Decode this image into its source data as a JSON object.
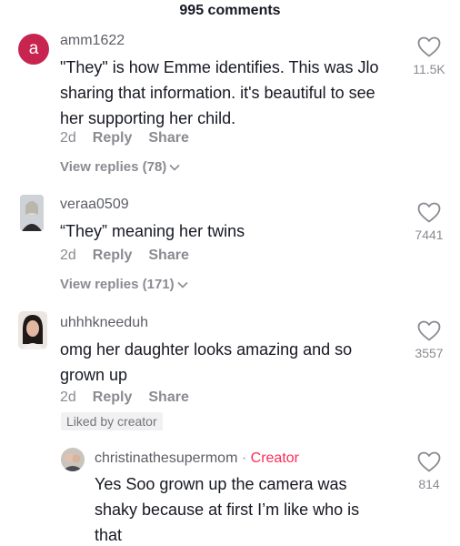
{
  "header": {
    "title": "995 comments"
  },
  "comments": [
    {
      "avatar_letter": "a",
      "avatar_color": "#c7254f",
      "username": "amm1622",
      "lines": [
        "\"They\" is how Emme identifies. This was Jlo",
        "sharing that information. it's beautiful to see",
        "her supporting her child."
      ],
      "time": "2d",
      "reply_label": "Reply",
      "share_label": "Share",
      "view_replies": "View replies (78)",
      "likes": "11.5K"
    },
    {
      "avatar_icon": "user-photo",
      "username": "veraa0509",
      "lines": [
        "“They” meaning her twins"
      ],
      "time": "2d",
      "reply_label": "Reply",
      "share_label": "Share",
      "view_replies": "View replies (171)",
      "likes": "7441"
    },
    {
      "avatar_icon": "user-photo",
      "username": "uhhhkneeduh",
      "lines": [
        "omg her daughter looks amazing and so",
        "grown up"
      ],
      "time": "2d",
      "reply_label": "Reply",
      "share_label": "Share",
      "liked_by": "Liked by creator",
      "likes": "3557"
    }
  ],
  "reply": {
    "avatar_icon": "user-photo",
    "username": "christinathesupermom",
    "separator": "·",
    "creator_label": "Creator",
    "lines": [
      "Yes Soo grown up the camera was",
      "shaky because at first I’m like who is",
      "that"
    ],
    "likes": "814"
  },
  "colors": {
    "accent": "#fe2c55",
    "secondary_text": "#8a8b91"
  }
}
